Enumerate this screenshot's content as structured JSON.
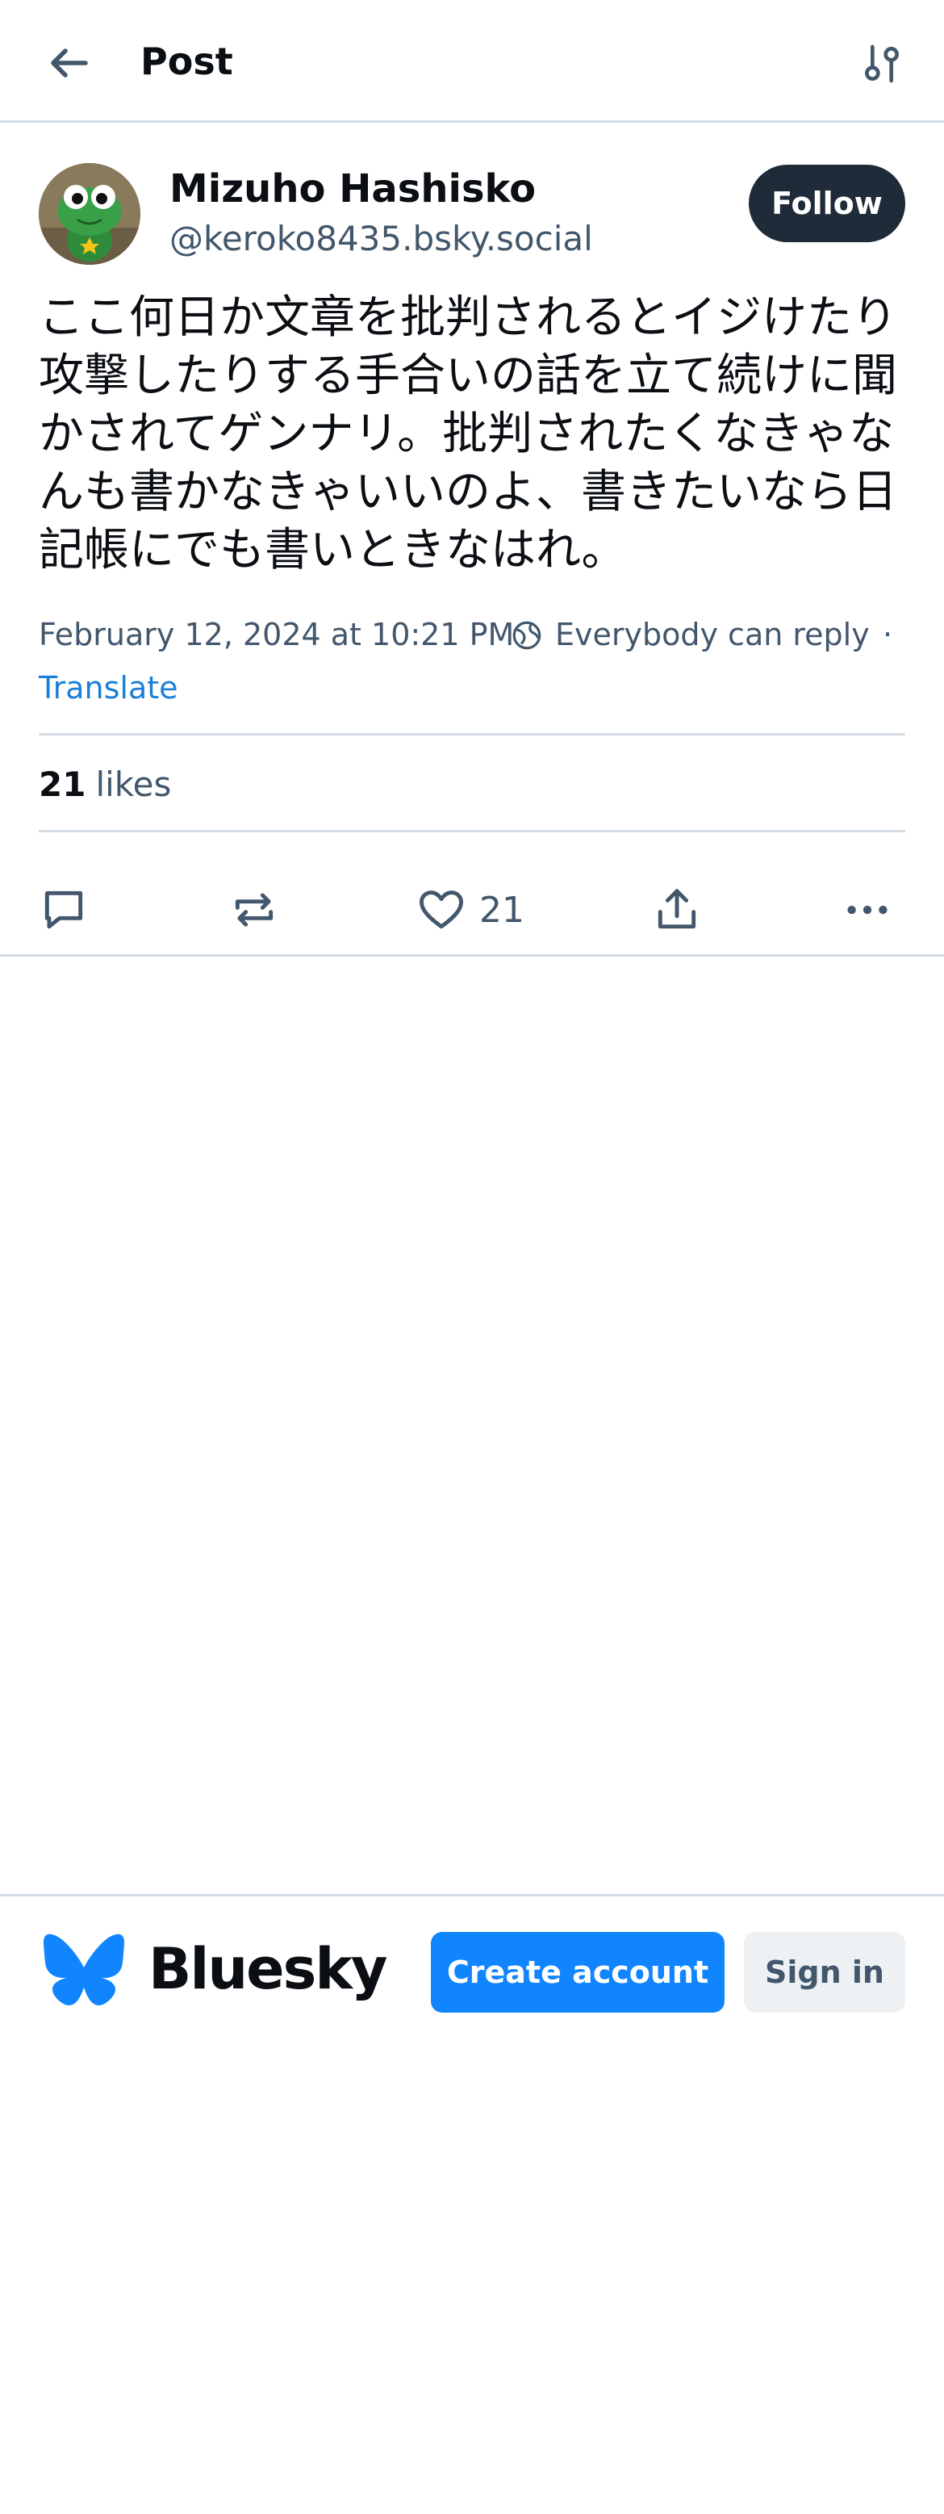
{
  "header": {
    "title": "Post",
    "back_icon": "arrow-left-icon",
    "filter_icon": "sliders-icon"
  },
  "post": {
    "author": {
      "name": "Mizuho Hashisko",
      "handle": "@keroko8435.bsky.social",
      "avatar": "frog-character-avatar"
    },
    "follow_label": "Follow",
    "text": "ここ何日か文章を批判されるとイジけたり攻撃したりする手合いの話を立て続けに聞かされてゲンナリ。批判されたくなきゃなんも書かなきゃいいのよ、書きたいなら日記帳にでも書いときなはれ。",
    "timestamp": "February 12, 2024 at 10:21 PM",
    "reply_setting": "Everybody can reply",
    "separator": "·",
    "translate_label": "Translate",
    "likes": {
      "count": "21",
      "label": "likes"
    },
    "actions": {
      "reply_icon": "comment-icon",
      "repost_icon": "repost-icon",
      "like_icon": "heart-icon",
      "like_count": "21",
      "share_icon": "share-icon",
      "more_icon": "ellipsis-icon"
    }
  },
  "footer": {
    "brand_name": "Bluesky",
    "create_account_label": "Create account",
    "sign_in_label": "Sign in"
  },
  "colors": {
    "accent": "#1185fe",
    "follow_bg": "#1f2b38",
    "link": "#1a7fd6",
    "muted_text": "#42576c",
    "border": "#d4dbe2"
  }
}
